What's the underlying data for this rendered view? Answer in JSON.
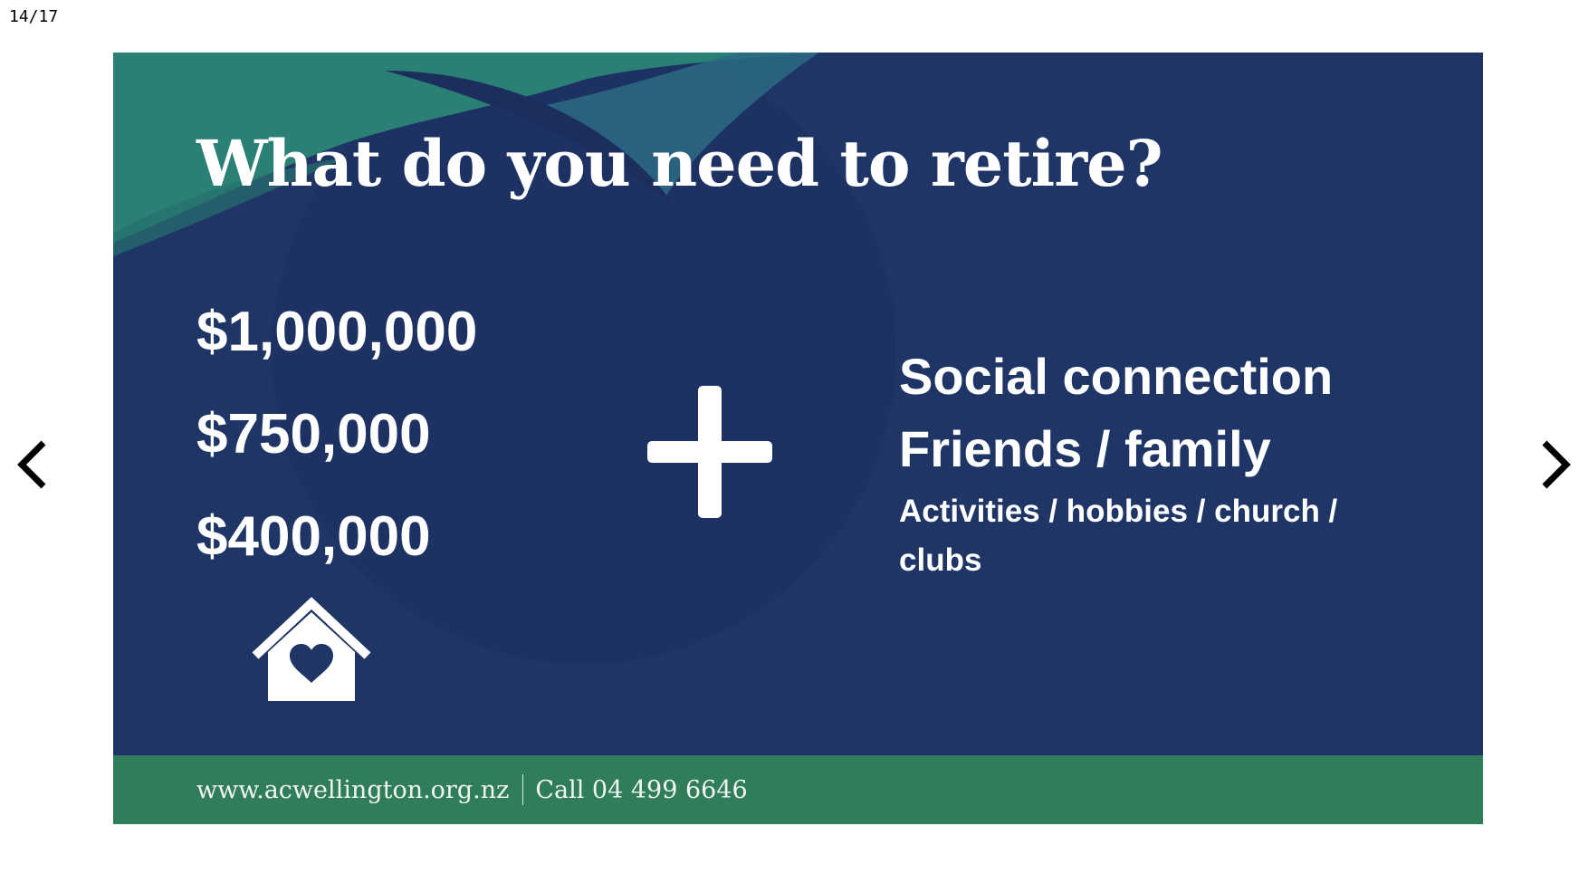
{
  "viewer": {
    "counter": "14/17",
    "prev_icon": "chevron-left-icon",
    "next_icon": "chevron-right-icon"
  },
  "slide": {
    "title": "What do you need to retire?",
    "amounts": [
      "$1,000,000",
      "$750,000",
      "$400,000"
    ],
    "house_icon": "house-heart-icon",
    "plus_icon": "plus-icon",
    "social": {
      "line1": "Social connection",
      "line2": "Friends / family",
      "line3": "Activities / hobbies / church / clubs"
    },
    "footer": {
      "url": "www.acwellington.org.nz",
      "phone": "Call 04 499 6646"
    },
    "colors": {
      "background": "#1e3566",
      "accent_green": "#2f7e59",
      "teal_swoosh": "#2a8075",
      "text": "#ffffff"
    }
  }
}
